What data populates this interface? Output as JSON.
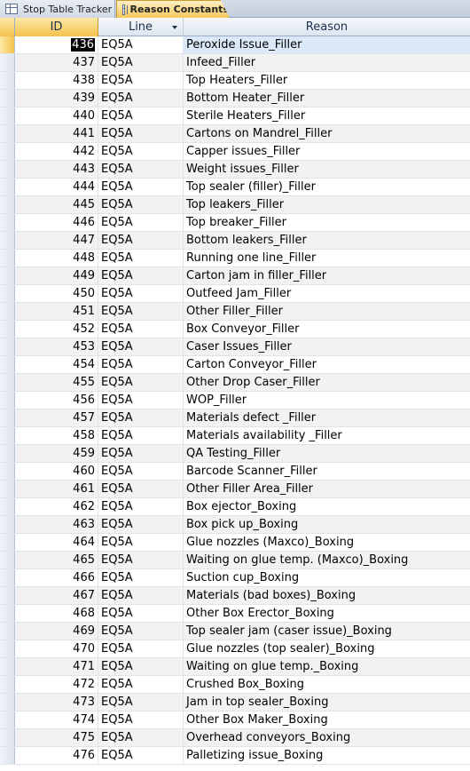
{
  "tabs": [
    {
      "label": "Stop Table Tracker",
      "active": false
    },
    {
      "label": "Reason Constants",
      "active": true
    }
  ],
  "columns": {
    "id": "ID",
    "line": "Line",
    "reason": "Reason"
  },
  "rows": [
    {
      "id": "436",
      "line": "EQ5A",
      "reason": "Peroxide Issue_Filler"
    },
    {
      "id": "437",
      "line": "EQ5A",
      "reason": "Infeed_Filler"
    },
    {
      "id": "438",
      "line": "EQ5A",
      "reason": "Top Heaters_Filler"
    },
    {
      "id": "439",
      "line": "EQ5A",
      "reason": "Bottom Heater_Filler"
    },
    {
      "id": "440",
      "line": "EQ5A",
      "reason": "Sterile Heaters_Filler"
    },
    {
      "id": "441",
      "line": "EQ5A",
      "reason": "Cartons on Mandrel_Filler"
    },
    {
      "id": "442",
      "line": "EQ5A",
      "reason": "Capper issues_Filler"
    },
    {
      "id": "443",
      "line": "EQ5A",
      "reason": "Weight issues_Filler"
    },
    {
      "id": "444",
      "line": "EQ5A",
      "reason": "Top sealer (filler)_Filler"
    },
    {
      "id": "445",
      "line": "EQ5A",
      "reason": "Top leakers_Filler"
    },
    {
      "id": "446",
      "line": "EQ5A",
      "reason": "Top breaker_Filler"
    },
    {
      "id": "447",
      "line": "EQ5A",
      "reason": "Bottom leakers_Filler"
    },
    {
      "id": "448",
      "line": "EQ5A",
      "reason": "Running one line_Filler"
    },
    {
      "id": "449",
      "line": "EQ5A",
      "reason": "Carton jam in filler_Filler"
    },
    {
      "id": "450",
      "line": "EQ5A",
      "reason": "Outfeed Jam_Filler"
    },
    {
      "id": "451",
      "line": "EQ5A",
      "reason": "Other Filler_Filler"
    },
    {
      "id": "452",
      "line": "EQ5A",
      "reason": "Box Conveyor_Filler"
    },
    {
      "id": "453",
      "line": "EQ5A",
      "reason": "Caser Issues_Filler"
    },
    {
      "id": "454",
      "line": "EQ5A",
      "reason": "Carton Conveyor_Filler"
    },
    {
      "id": "455",
      "line": "EQ5A",
      "reason": "Other Drop Caser_Filler"
    },
    {
      "id": "456",
      "line": "EQ5A",
      "reason": "WOP_Filler"
    },
    {
      "id": "457",
      "line": "EQ5A",
      "reason": "Materials defect _Filler"
    },
    {
      "id": "458",
      "line": "EQ5A",
      "reason": "Materials availability _Filler"
    },
    {
      "id": "459",
      "line": "EQ5A",
      "reason": "QA Testing_Filler"
    },
    {
      "id": "460",
      "line": "EQ5A",
      "reason": "Barcode Scanner_Filler"
    },
    {
      "id": "461",
      "line": "EQ5A",
      "reason": "Other Filler Area_Filler"
    },
    {
      "id": "462",
      "line": "EQ5A",
      "reason": "Box ejector_Boxing"
    },
    {
      "id": "463",
      "line": "EQ5A",
      "reason": "Box pick up_Boxing"
    },
    {
      "id": "464",
      "line": "EQ5A",
      "reason": "Glue nozzles (Maxco)_Boxing"
    },
    {
      "id": "465",
      "line": "EQ5A",
      "reason": "Waiting on glue temp. (Maxco)_Boxing"
    },
    {
      "id": "466",
      "line": "EQ5A",
      "reason": "Suction cup_Boxing"
    },
    {
      "id": "467",
      "line": "EQ5A",
      "reason": "Materials (bad boxes)_Boxing"
    },
    {
      "id": "468",
      "line": "EQ5A",
      "reason": "Other Box Erector_Boxing"
    },
    {
      "id": "469",
      "line": "EQ5A",
      "reason": "Top sealer jam (caser issue)_Boxing"
    },
    {
      "id": "470",
      "line": "EQ5A",
      "reason": "Glue nozzles (top sealer)_Boxing"
    },
    {
      "id": "471",
      "line": "EQ5A",
      "reason": "Waiting on glue temp._Boxing"
    },
    {
      "id": "472",
      "line": "EQ5A",
      "reason": "Crushed Box_Boxing"
    },
    {
      "id": "473",
      "line": "EQ5A",
      "reason": "Jam in top sealer_Boxing"
    },
    {
      "id": "474",
      "line": "EQ5A",
      "reason": "Other Box Maker_Boxing"
    },
    {
      "id": "475",
      "line": "EQ5A",
      "reason": "Overhead conveyors_Boxing"
    },
    {
      "id": "476",
      "line": "EQ5A",
      "reason": "Palletizing issue_Boxing"
    }
  ]
}
